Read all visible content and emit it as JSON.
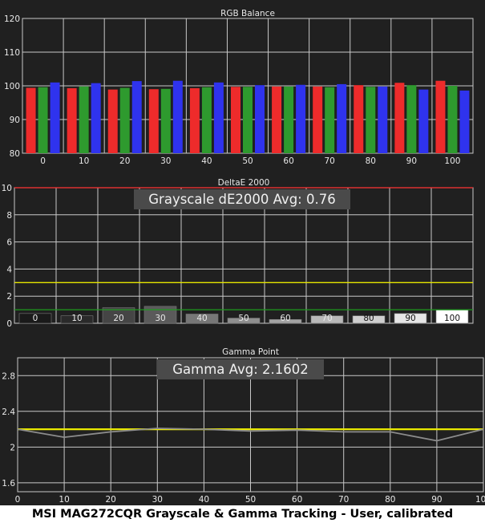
{
  "caption": "MSI MAG272CQR Grayscale & Gamma Tracking - User, calibrated",
  "colors": {
    "background": "#202020",
    "grid": "#c8c8c8",
    "text": "#e8e8e8",
    "red": "#ee2b2b",
    "green": "#2e9a2e",
    "blue": "#2f33ee",
    "threshold_red": "#ff3333",
    "threshold_yellow": "#e6e600",
    "threshold_green": "#1e9a1e",
    "gamma_target": "#e8e800",
    "gamma_measured": "#8c8c8c",
    "annotation_bg": "#4a4a4a"
  },
  "chart_data": [
    {
      "type": "bar",
      "title": "RGB Balance",
      "categories": [
        "0",
        "10",
        "20",
        "30",
        "40",
        "50",
        "60",
        "70",
        "80",
        "90",
        "100"
      ],
      "ylim": [
        80,
        120
      ],
      "yticks": [
        80,
        90,
        100,
        110,
        120
      ],
      "grid": true,
      "series": [
        {
          "color": "red",
          "values": [
            99.4,
            99.3,
            98.9,
            99.0,
            99.3,
            99.7,
            99.8,
            99.8,
            100.2,
            100.9,
            101.5
          ]
        },
        {
          "color": "green",
          "values": [
            99.6,
            99.8,
            99.4,
            99.1,
            99.6,
            99.7,
            99.8,
            99.6,
            99.7,
            100.2,
            100.0
          ]
        },
        {
          "color": "blue",
          "values": [
            101.0,
            100.8,
            101.4,
            101.5,
            101.0,
            100.2,
            100.3,
            100.5,
            99.8,
            98.9,
            98.6
          ]
        }
      ]
    },
    {
      "type": "bar",
      "title": "DeltaE 2000",
      "annotation": "Grayscale dE2000 Avg: 0.76",
      "categories": [
        "0",
        "10",
        "20",
        "30",
        "40",
        "50",
        "60",
        "70",
        "80",
        "90",
        "100"
      ],
      "ylim": [
        0,
        10
      ],
      "yticks": [
        0,
        2,
        4,
        6,
        8,
        10
      ],
      "grid": true,
      "thresholds": [
        {
          "value": 10,
          "color": "threshold_red"
        },
        {
          "value": 3,
          "color": "threshold_yellow"
        },
        {
          "value": 1,
          "color": "threshold_green"
        }
      ],
      "values": [
        0.72,
        0.55,
        1.15,
        1.25,
        0.68,
        0.38,
        0.28,
        0.55,
        0.55,
        0.72,
        0.98
      ],
      "bar_shades": [
        "#1a1a1a",
        "#2a2a2a",
        "#454545",
        "#5a5a5a",
        "#777777",
        "#8f8f8f",
        "#a3a3a3",
        "#b9b9b9",
        "#cfcfcf",
        "#e6e6e6",
        "#ffffff"
      ]
    },
    {
      "type": "line",
      "title": "Gamma Point",
      "annotation": "Gamma Avg: 2.1602",
      "x": [
        0,
        10,
        20,
        30,
        40,
        50,
        60,
        70,
        80,
        90,
        100
      ],
      "xlim": [
        0,
        100
      ],
      "xticks": [
        0,
        10,
        20,
        30,
        40,
        50,
        60,
        70,
        80,
        90,
        100
      ],
      "ylim": [
        1.5,
        3.0
      ],
      "yticks": [
        1.6,
        2,
        2.4,
        2.8
      ],
      "grid": true,
      "series": [
        {
          "color": "gamma_target",
          "values": [
            2.2,
            2.2,
            2.2,
            2.2,
            2.2,
            2.2,
            2.2,
            2.2,
            2.2,
            2.2,
            2.2
          ]
        },
        {
          "color": "gamma_measured",
          "values": [
            2.2,
            2.11,
            2.17,
            2.21,
            2.2,
            2.18,
            2.19,
            2.17,
            2.17,
            2.07,
            2.2
          ]
        }
      ]
    }
  ]
}
